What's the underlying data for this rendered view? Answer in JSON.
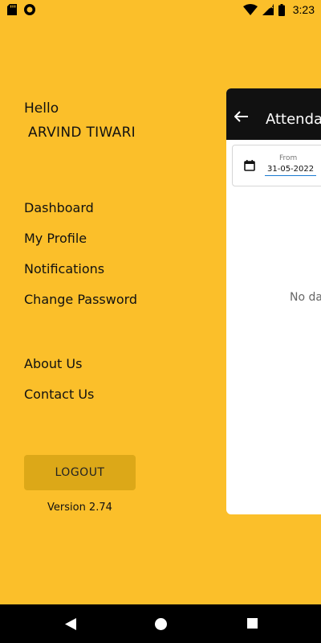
{
  "status_bar": {
    "time": "3:23"
  },
  "drawer": {
    "greeting": "Hello",
    "user_name": "ARVIND TIWARI",
    "menu_items": [
      "Dashboard",
      "My Profile",
      "Notifications",
      "Change Password"
    ],
    "secondary_items": [
      "About Us",
      "Contact Us"
    ],
    "logout_label": "LOGOUT",
    "version": "Version 2.74"
  },
  "main": {
    "title": "Attendance",
    "from_label": "From",
    "from_date": "31-05-2022",
    "empty_text": "No data"
  },
  "colors": {
    "background": "#FBBF2A",
    "logout_button": "#DCA818",
    "appbar": "#111111"
  }
}
